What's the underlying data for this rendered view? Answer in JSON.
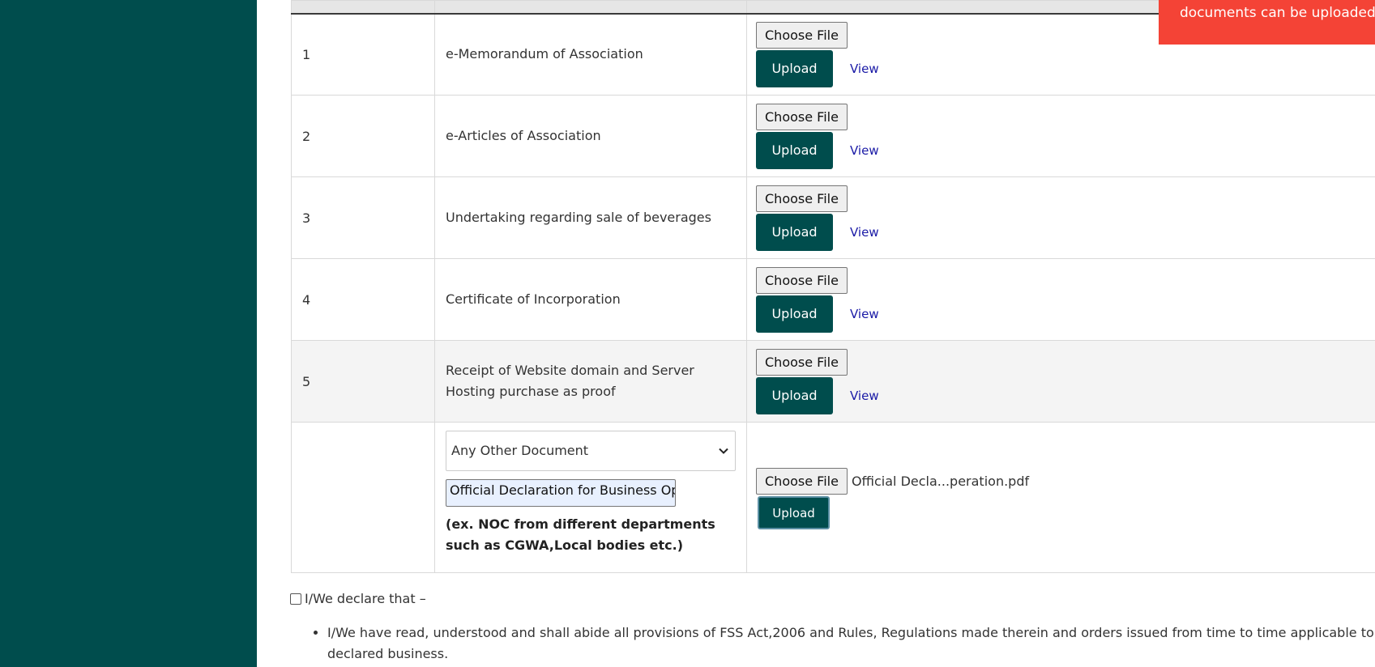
{
  "colors": {
    "sidebar": "#004d4d",
    "button": "#004d4d",
    "toast": "#f44336",
    "link": "#1a1aa6"
  },
  "toast": {
    "text": "documents can be uploaded."
  },
  "documents": [
    {
      "serial": "1",
      "name": "e-Memorandum of Association",
      "choose_label": "Choose File",
      "upload_label": "Upload",
      "view_label": "View"
    },
    {
      "serial": "2",
      "name": "e-Articles of Association",
      "choose_label": "Choose File",
      "upload_label": "Upload",
      "view_label": "View"
    },
    {
      "serial": "3",
      "name": "Undertaking regarding sale of beverages",
      "choose_label": "Choose File",
      "upload_label": "Upload",
      "view_label": "View"
    },
    {
      "serial": "4",
      "name": "Certificate of Incorporation",
      "choose_label": "Choose File",
      "upload_label": "Upload",
      "view_label": "View"
    },
    {
      "serial": "5",
      "name": "Receipt of Website domain and Server Hosting purchase as proof",
      "choose_label": "Choose File",
      "upload_label": "Upload",
      "view_label": "View"
    }
  ],
  "other_document": {
    "select_value": "Any Other Document",
    "input_value": "Official Declaration for Business Ope",
    "hint": "(ex. NOC from different departments such as CGWA,Local bodies etc.)",
    "choose_label": "Choose File",
    "file_name": "Official Decla...peration.pdf",
    "upload_label": "Upload"
  },
  "declaration": {
    "label": "I/We declare that –",
    "items": [
      "I/We have read, understood and shall abide all provisions of FSS Act,2006 and Rules, Regulations made therein and orders issued from time to time applicable to declared business."
    ]
  }
}
